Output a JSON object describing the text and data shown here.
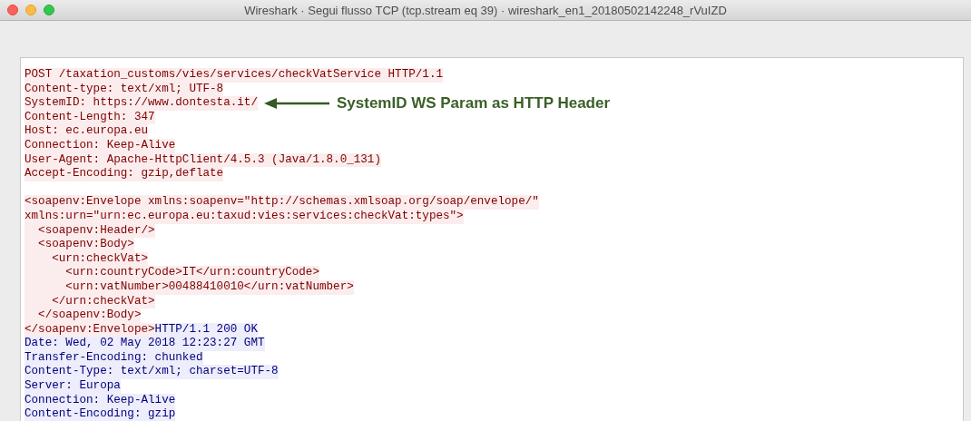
{
  "window": {
    "title": "Wireshark · Segui flusso TCP (tcp.stream eq 39) · wireshark_en1_20180502142248_rVuIZD"
  },
  "stream": [
    {
      "segments": [
        {
          "kind": "client",
          "text": "POST /taxation_customs/vies/services/checkVatService HTTP/1.1"
        }
      ]
    },
    {
      "segments": [
        {
          "kind": "client",
          "text": "Content-type: text/xml; UTF-8"
        }
      ]
    },
    {
      "segments": [
        {
          "kind": "client",
          "text": "SystemID: https://www.dontesta.it/"
        }
      ],
      "annotation": "SystemID WS Param as HTTP Header"
    },
    {
      "segments": [
        {
          "kind": "client",
          "text": "Content-Length: 347"
        }
      ]
    },
    {
      "segments": [
        {
          "kind": "client",
          "text": "Host: ec.europa.eu"
        }
      ]
    },
    {
      "segments": [
        {
          "kind": "client",
          "text": "Connection: Keep-Alive"
        }
      ]
    },
    {
      "segments": [
        {
          "kind": "client",
          "text": "User-Agent: Apache-HttpClient/4.5.3 (Java/1.8.0_131)"
        }
      ]
    },
    {
      "segments": [
        {
          "kind": "client",
          "text": "Accept-Encoding: gzip,deflate"
        }
      ]
    },
    {
      "blank_before": true,
      "segments": [
        {
          "kind": "client",
          "text": "<soapenv:Envelope xmlns:soapenv=\"http://schemas.xmlsoap.org/soap/envelope/\""
        }
      ]
    },
    {
      "segments": [
        {
          "kind": "client",
          "text": "xmlns:urn=\"urn:ec.europa.eu:taxud:vies:services:checkVat:types\">"
        }
      ]
    },
    {
      "segments": [
        {
          "kind": "client",
          "text": "  <soapenv:Header/>"
        }
      ]
    },
    {
      "segments": [
        {
          "kind": "client",
          "text": "  <soapenv:Body>"
        }
      ]
    },
    {
      "segments": [
        {
          "kind": "client",
          "text": "    <urn:checkVat>"
        }
      ]
    },
    {
      "segments": [
        {
          "kind": "client",
          "text": "      <urn:countryCode>IT</urn:countryCode>"
        }
      ]
    },
    {
      "segments": [
        {
          "kind": "client",
          "text": "      <urn:vatNumber>00488410010</urn:vatNumber>"
        }
      ]
    },
    {
      "segments": [
        {
          "kind": "client",
          "text": "    </urn:checkVat>"
        }
      ]
    },
    {
      "segments": [
        {
          "kind": "client",
          "text": "  </soapenv:Body>"
        }
      ]
    },
    {
      "segments": [
        {
          "kind": "client",
          "text": "</soapenv:Envelope>"
        },
        {
          "kind": "server",
          "text": "HTTP/1.1 200 OK"
        }
      ]
    },
    {
      "segments": [
        {
          "kind": "server",
          "text": "Date: Wed, 02 May 2018 12:23:27 GMT"
        }
      ]
    },
    {
      "segments": [
        {
          "kind": "server",
          "text": "Transfer-Encoding: chunked"
        }
      ]
    },
    {
      "segments": [
        {
          "kind": "server",
          "text": "Content-Type: text/xml; charset=UTF-8"
        }
      ]
    },
    {
      "segments": [
        {
          "kind": "server",
          "text": "Server: Europa"
        }
      ]
    },
    {
      "segments": [
        {
          "kind": "server",
          "text": "Connection: Keep-Alive"
        }
      ]
    },
    {
      "segments": [
        {
          "kind": "server",
          "text": "Content-Encoding: gzip"
        }
      ]
    }
  ]
}
